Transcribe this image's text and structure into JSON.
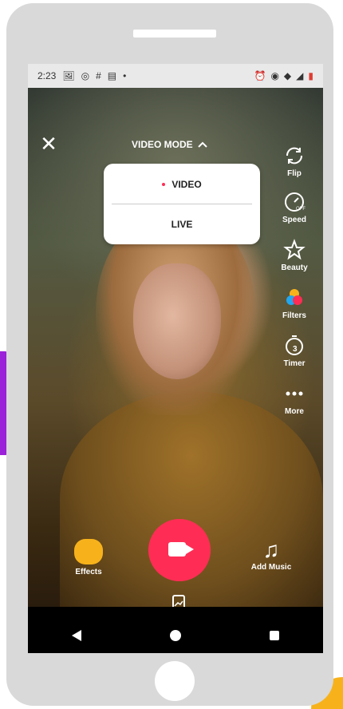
{
  "status": {
    "time": "2:23",
    "left_icons": [
      "image-icon",
      "whatsapp-icon",
      "slack-icon",
      "message-icon",
      "dot-icon"
    ],
    "right_icons": [
      "alarm-icon",
      "vibrate-icon",
      "wifi-icon",
      "signal-icon",
      "battery-icon"
    ]
  },
  "header": {
    "close_label": "✕",
    "mode_title": "VIDEO MODE"
  },
  "dropdown": {
    "options": [
      "VIDEO",
      "LIVE"
    ],
    "selected": "VIDEO"
  },
  "tools": {
    "flip": "Flip",
    "speed": "Speed",
    "beauty": "Beauty",
    "filters": "Filters",
    "timer": "Timer",
    "more": "More"
  },
  "bottom": {
    "effects": "Effects",
    "add_music": "Add Music",
    "music_icon": "♫"
  },
  "colors": {
    "record": "#ff2d55",
    "effects": "#f7b21b",
    "accent_purple": "#9b22d8"
  }
}
